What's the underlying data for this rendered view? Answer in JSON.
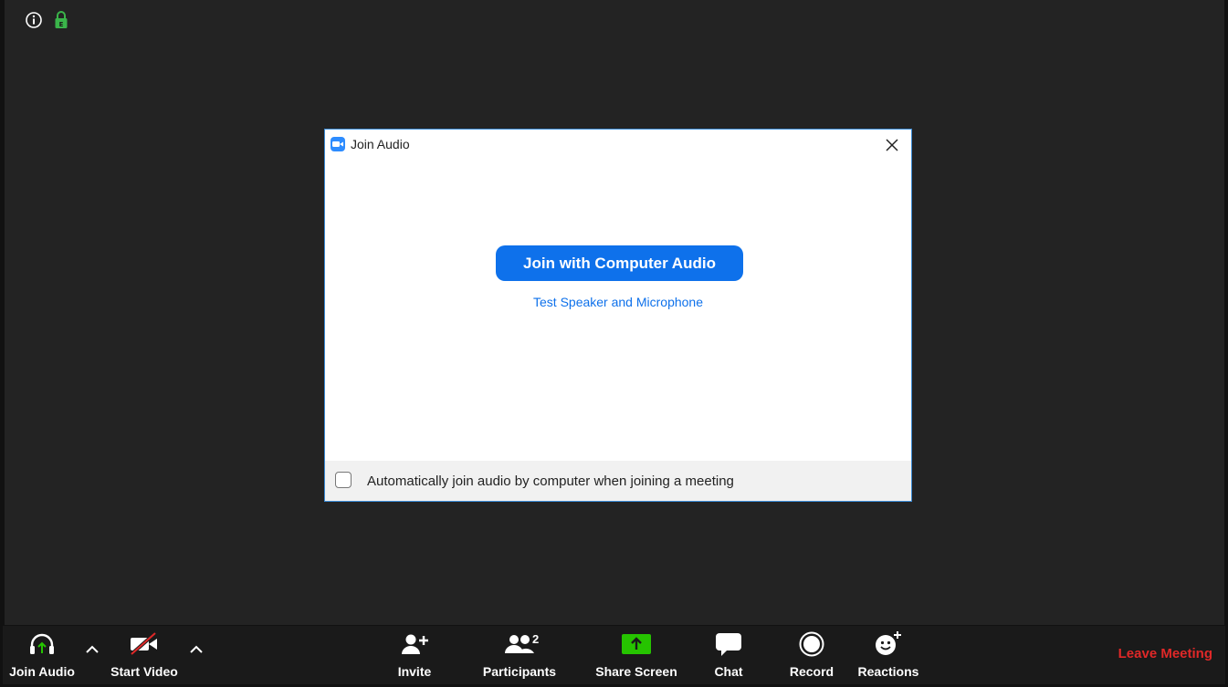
{
  "dialog": {
    "title": "Join Audio",
    "join_button": "Join with Computer Audio",
    "test_link": "Test Speaker and Microphone",
    "auto_join_label": "Automatically join audio by computer when joining a meeting",
    "auto_join_checked": false
  },
  "toolbar": {
    "join_audio": "Join Audio",
    "start_video": "Start Video",
    "invite": "Invite",
    "participants": "Participants",
    "participants_count": "2",
    "share_screen": "Share Screen",
    "chat": "Chat",
    "record": "Record",
    "reactions": "Reactions",
    "leave": "Leave Meeting"
  },
  "colors": {
    "accent": "#0e71eb",
    "share_green": "#26c400",
    "leave_red": "#e02828",
    "lock_green": "#3ab44a"
  },
  "icons": [
    "info-icon",
    "lock-icon",
    "zoom-logo-icon",
    "close-icon",
    "headphones-icon",
    "video-off-icon",
    "caret-up-icon",
    "add-person-icon",
    "participants-icon",
    "share-screen-icon",
    "chat-icon",
    "record-icon",
    "reactions-icon"
  ]
}
